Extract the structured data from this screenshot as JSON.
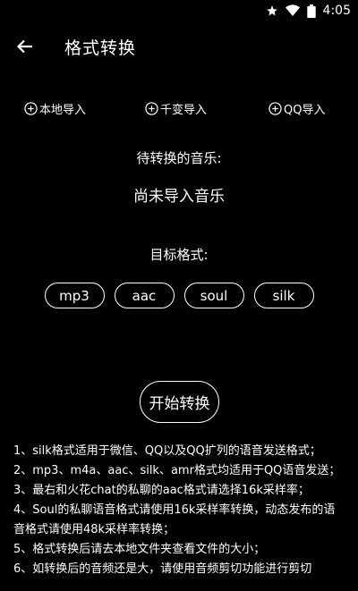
{
  "status_bar": {
    "time": "4:05"
  },
  "app_bar": {
    "title": "格式转换"
  },
  "import": [
    {
      "label": "本地导入"
    },
    {
      "label": "千变导入"
    },
    {
      "label": "QQ导入"
    }
  ],
  "pending": {
    "label": "待转换的音乐:",
    "value": "尚未导入音乐"
  },
  "target": {
    "label": "目标格式:"
  },
  "formats": [
    "mp3",
    "aac",
    "soul",
    "silk"
  ],
  "start_button": "开始转换",
  "notes": [
    "1、silk格式适用于微信、QQ以及QQ扩列的语音发送格式；",
    "2、mp3、m4a、aac、silk、amr格式均适用于QQ语音发送；",
    "3、最右和火花chat的私聊的aac格式请选择16k采样率；",
    "4、Soul的私聊语音格式请使用16k采样率转换，动态发布的语音格式请使用48k采样率转换；",
    "5、格式转换后请去本地文件夹查看文件的大小；",
    "6、如转换后的音频还是大，请使用音频剪切功能进行剪切"
  ]
}
